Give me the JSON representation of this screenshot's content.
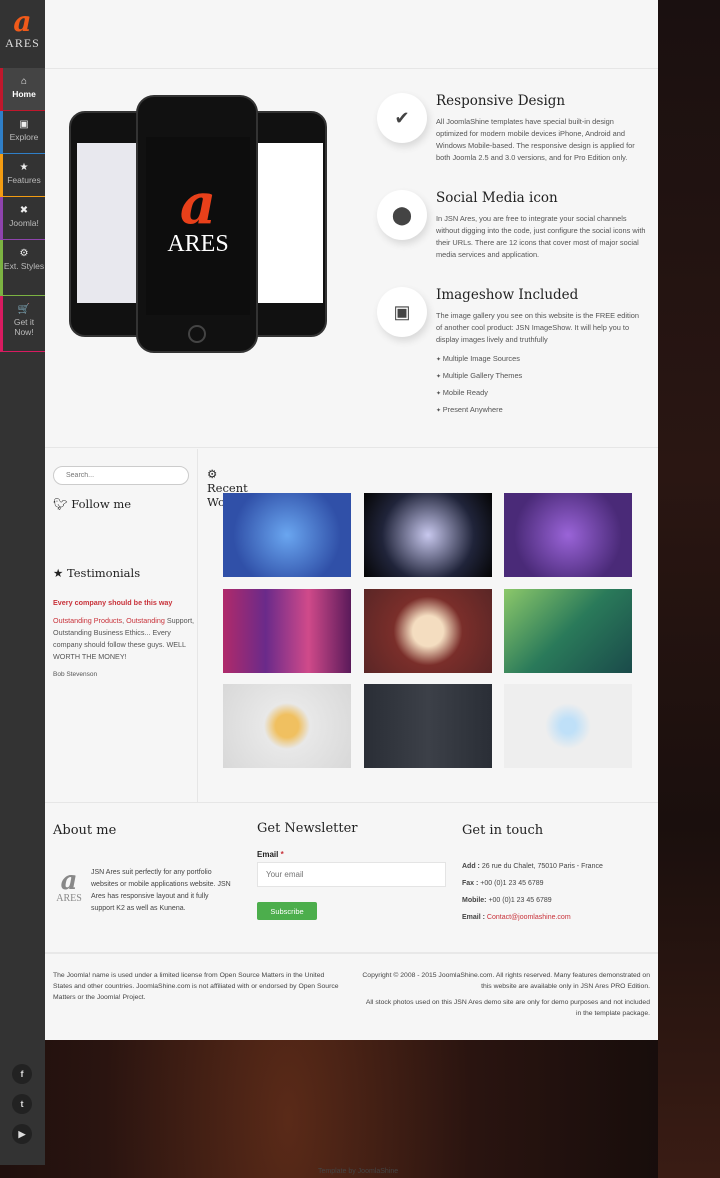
{
  "brand": {
    "name": "ARES"
  },
  "nav": [
    {
      "label": "Home",
      "icon": "home-icon",
      "color": "#c0172c"
    },
    {
      "label": "Explore",
      "icon": "image-icon",
      "color": "#2f7fc8"
    },
    {
      "label": "Features",
      "icon": "star-icon",
      "color": "#f39c12"
    },
    {
      "label": "Joomla!",
      "icon": "joomla-icon",
      "color": "#8e44ad"
    },
    {
      "label": "Ext. Styles",
      "icon": "gear-icon",
      "color": "#7cb342"
    },
    {
      "label": "Get it Now!",
      "icon": "cart-icon",
      "color": "#d81b60"
    }
  ],
  "social": [
    "facebook",
    "twitter",
    "youtube"
  ],
  "features": [
    {
      "title": "Responsive Design",
      "icon": "check-circle-icon",
      "text": "All JoomlaShine templates have special built-in design optimized for modern mobile devices iPhone, Android and Windows Mobile-based. The responsive design is applied for both Joomla 2.5 and 3.0 versions, and for Pro Edition only."
    },
    {
      "title": "Social Media icon",
      "icon": "map-marker-icon",
      "text": "In JSN Ares, you are free to integrate your social channels without digging into the code, just configure the social icons with their URLs. There are 12 icons that cover most of major social media services and application."
    },
    {
      "title": "Imageshow Included",
      "icon": "picture-icon",
      "text": "The image gallery you see on this website is the FREE edition of another cool product: JSN ImageShow. It will help you to display images lively and truthfully",
      "list": [
        "Multiple Image Sources",
        "Multiple Gallery Themes",
        "Mobile Ready",
        "Present Anywhere"
      ]
    }
  ],
  "sidebar": {
    "search_placeholder": "Search...",
    "follow": "Follow me",
    "testimonials": "Testimonials",
    "t_title": "Every company should be this way",
    "t_link1": "Outstanding Products",
    "t_link2": "Outstanding",
    "t_body": " Support, Outstanding Business Ethics... Every company should follow these guys. WELL WORTH THE MONEY!",
    "t_author": "Bob Stevenson"
  },
  "recent": {
    "title": "Recent Works"
  },
  "footer": {
    "about_title": "About me",
    "about_text": "JSN Ares suit perfectly for any portfolio websites or mobile applications website. JSN Ares has responsive layout and it fully support K2 as well as Kunena.",
    "news_title": "Get Newsletter",
    "email_label": "Email",
    "email_placeholder": "Your email",
    "subscribe": "Subscribe",
    "touch_title": "Get in touch",
    "add_l": "Add :",
    "add": " 26 rue du Chalet, 75010 Paris - France",
    "fax_l": "Fax :",
    "fax": " +00 (0)1 23 45 6789",
    "mob_l": "Mobile:",
    "mob": " +00 (0)1 23 45 6789",
    "mail_l": "Email :",
    "mail": "Contact@joomlashine.com"
  },
  "copyright": {
    "left": "The Joomla! name is used under a limited license from Open Source Matters in the United States and other countries. JoomlaShine.com is not affiliated with or endorsed by Open Source Matters or the Joomla! Project.",
    "right1": "Copyright © 2008 - 2015 JoomlaShine.com. All rights reserved. Many features demonstrated on this website are available only in JSN Ares PRO Edition.",
    "right2": "All stock photos used on this JSN Ares demo site are only for demo purposes and not included in the template package."
  },
  "credit": "Template by JoomlaShine"
}
